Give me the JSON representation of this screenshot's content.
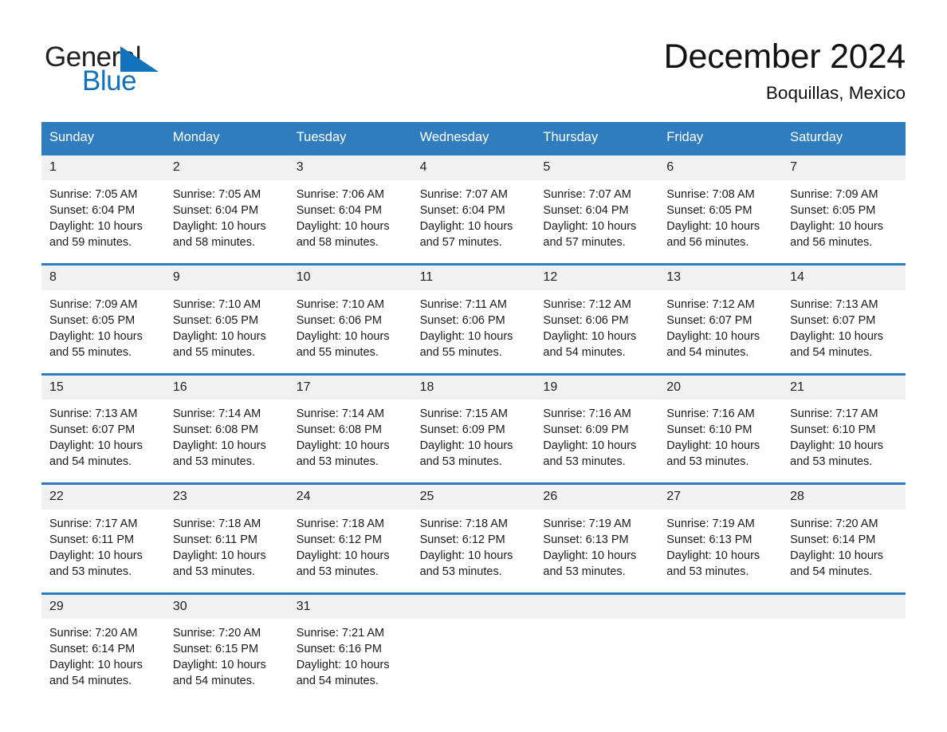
{
  "brand": {
    "name_part1": "General",
    "name_part2": "Blue",
    "triangle_color": "#1272bb",
    "text_color": "#231f20"
  },
  "header": {
    "title": "December 2024",
    "subtitle": "Boquillas, Mexico",
    "accent_color": "#2f7dbe"
  },
  "calendar": {
    "weekday_headers": [
      "Sunday",
      "Monday",
      "Tuesday",
      "Wednesday",
      "Thursday",
      "Friday",
      "Saturday"
    ],
    "weeks": [
      [
        {
          "day": "1",
          "sunrise": "Sunrise: 7:05 AM",
          "sunset": "Sunset: 6:04 PM",
          "daylight_line1": "Daylight: 10 hours",
          "daylight_line2": "and 59 minutes."
        },
        {
          "day": "2",
          "sunrise": "Sunrise: 7:05 AM",
          "sunset": "Sunset: 6:04 PM",
          "daylight_line1": "Daylight: 10 hours",
          "daylight_line2": "and 58 minutes."
        },
        {
          "day": "3",
          "sunrise": "Sunrise: 7:06 AM",
          "sunset": "Sunset: 6:04 PM",
          "daylight_line1": "Daylight: 10 hours",
          "daylight_line2": "and 58 minutes."
        },
        {
          "day": "4",
          "sunrise": "Sunrise: 7:07 AM",
          "sunset": "Sunset: 6:04 PM",
          "daylight_line1": "Daylight: 10 hours",
          "daylight_line2": "and 57 minutes."
        },
        {
          "day": "5",
          "sunrise": "Sunrise: 7:07 AM",
          "sunset": "Sunset: 6:04 PM",
          "daylight_line1": "Daylight: 10 hours",
          "daylight_line2": "and 57 minutes."
        },
        {
          "day": "6",
          "sunrise": "Sunrise: 7:08 AM",
          "sunset": "Sunset: 6:05 PM",
          "daylight_line1": "Daylight: 10 hours",
          "daylight_line2": "and 56 minutes."
        },
        {
          "day": "7",
          "sunrise": "Sunrise: 7:09 AM",
          "sunset": "Sunset: 6:05 PM",
          "daylight_line1": "Daylight: 10 hours",
          "daylight_line2": "and 56 minutes."
        }
      ],
      [
        {
          "day": "8",
          "sunrise": "Sunrise: 7:09 AM",
          "sunset": "Sunset: 6:05 PM",
          "daylight_line1": "Daylight: 10 hours",
          "daylight_line2": "and 55 minutes."
        },
        {
          "day": "9",
          "sunrise": "Sunrise: 7:10 AM",
          "sunset": "Sunset: 6:05 PM",
          "daylight_line1": "Daylight: 10 hours",
          "daylight_line2": "and 55 minutes."
        },
        {
          "day": "10",
          "sunrise": "Sunrise: 7:10 AM",
          "sunset": "Sunset: 6:06 PM",
          "daylight_line1": "Daylight: 10 hours",
          "daylight_line2": "and 55 minutes."
        },
        {
          "day": "11",
          "sunrise": "Sunrise: 7:11 AM",
          "sunset": "Sunset: 6:06 PM",
          "daylight_line1": "Daylight: 10 hours",
          "daylight_line2": "and 55 minutes."
        },
        {
          "day": "12",
          "sunrise": "Sunrise: 7:12 AM",
          "sunset": "Sunset: 6:06 PM",
          "daylight_line1": "Daylight: 10 hours",
          "daylight_line2": "and 54 minutes."
        },
        {
          "day": "13",
          "sunrise": "Sunrise: 7:12 AM",
          "sunset": "Sunset: 6:07 PM",
          "daylight_line1": "Daylight: 10 hours",
          "daylight_line2": "and 54 minutes."
        },
        {
          "day": "14",
          "sunrise": "Sunrise: 7:13 AM",
          "sunset": "Sunset: 6:07 PM",
          "daylight_line1": "Daylight: 10 hours",
          "daylight_line2": "and 54 minutes."
        }
      ],
      [
        {
          "day": "15",
          "sunrise": "Sunrise: 7:13 AM",
          "sunset": "Sunset: 6:07 PM",
          "daylight_line1": "Daylight: 10 hours",
          "daylight_line2": "and 54 minutes."
        },
        {
          "day": "16",
          "sunrise": "Sunrise: 7:14 AM",
          "sunset": "Sunset: 6:08 PM",
          "daylight_line1": "Daylight: 10 hours",
          "daylight_line2": "and 53 minutes."
        },
        {
          "day": "17",
          "sunrise": "Sunrise: 7:14 AM",
          "sunset": "Sunset: 6:08 PM",
          "daylight_line1": "Daylight: 10 hours",
          "daylight_line2": "and 53 minutes."
        },
        {
          "day": "18",
          "sunrise": "Sunrise: 7:15 AM",
          "sunset": "Sunset: 6:09 PM",
          "daylight_line1": "Daylight: 10 hours",
          "daylight_line2": "and 53 minutes."
        },
        {
          "day": "19",
          "sunrise": "Sunrise: 7:16 AM",
          "sunset": "Sunset: 6:09 PM",
          "daylight_line1": "Daylight: 10 hours",
          "daylight_line2": "and 53 minutes."
        },
        {
          "day": "20",
          "sunrise": "Sunrise: 7:16 AM",
          "sunset": "Sunset: 6:10 PM",
          "daylight_line1": "Daylight: 10 hours",
          "daylight_line2": "and 53 minutes."
        },
        {
          "day": "21",
          "sunrise": "Sunrise: 7:17 AM",
          "sunset": "Sunset: 6:10 PM",
          "daylight_line1": "Daylight: 10 hours",
          "daylight_line2": "and 53 minutes."
        }
      ],
      [
        {
          "day": "22",
          "sunrise": "Sunrise: 7:17 AM",
          "sunset": "Sunset: 6:11 PM",
          "daylight_line1": "Daylight: 10 hours",
          "daylight_line2": "and 53 minutes."
        },
        {
          "day": "23",
          "sunrise": "Sunrise: 7:18 AM",
          "sunset": "Sunset: 6:11 PM",
          "daylight_line1": "Daylight: 10 hours",
          "daylight_line2": "and 53 minutes."
        },
        {
          "day": "24",
          "sunrise": "Sunrise: 7:18 AM",
          "sunset": "Sunset: 6:12 PM",
          "daylight_line1": "Daylight: 10 hours",
          "daylight_line2": "and 53 minutes."
        },
        {
          "day": "25",
          "sunrise": "Sunrise: 7:18 AM",
          "sunset": "Sunset: 6:12 PM",
          "daylight_line1": "Daylight: 10 hours",
          "daylight_line2": "and 53 minutes."
        },
        {
          "day": "26",
          "sunrise": "Sunrise: 7:19 AM",
          "sunset": "Sunset: 6:13 PM",
          "daylight_line1": "Daylight: 10 hours",
          "daylight_line2": "and 53 minutes."
        },
        {
          "day": "27",
          "sunrise": "Sunrise: 7:19 AM",
          "sunset": "Sunset: 6:13 PM",
          "daylight_line1": "Daylight: 10 hours",
          "daylight_line2": "and 53 minutes."
        },
        {
          "day": "28",
          "sunrise": "Sunrise: 7:20 AM",
          "sunset": "Sunset: 6:14 PM",
          "daylight_line1": "Daylight: 10 hours",
          "daylight_line2": "and 54 minutes."
        }
      ],
      [
        {
          "day": "29",
          "sunrise": "Sunrise: 7:20 AM",
          "sunset": "Sunset: 6:14 PM",
          "daylight_line1": "Daylight: 10 hours",
          "daylight_line2": "and 54 minutes."
        },
        {
          "day": "30",
          "sunrise": "Sunrise: 7:20 AM",
          "sunset": "Sunset: 6:15 PM",
          "daylight_line1": "Daylight: 10 hours",
          "daylight_line2": "and 54 minutes."
        },
        {
          "day": "31",
          "sunrise": "Sunrise: 7:21 AM",
          "sunset": "Sunset: 6:16 PM",
          "daylight_line1": "Daylight: 10 hours",
          "daylight_line2": "and 54 minutes."
        },
        {
          "day": "",
          "sunrise": "",
          "sunset": "",
          "daylight_line1": "",
          "daylight_line2": ""
        },
        {
          "day": "",
          "sunrise": "",
          "sunset": "",
          "daylight_line1": "",
          "daylight_line2": ""
        },
        {
          "day": "",
          "sunrise": "",
          "sunset": "",
          "daylight_line1": "",
          "daylight_line2": ""
        },
        {
          "day": "",
          "sunrise": "",
          "sunset": "",
          "daylight_line1": "",
          "daylight_line2": ""
        }
      ]
    ]
  }
}
